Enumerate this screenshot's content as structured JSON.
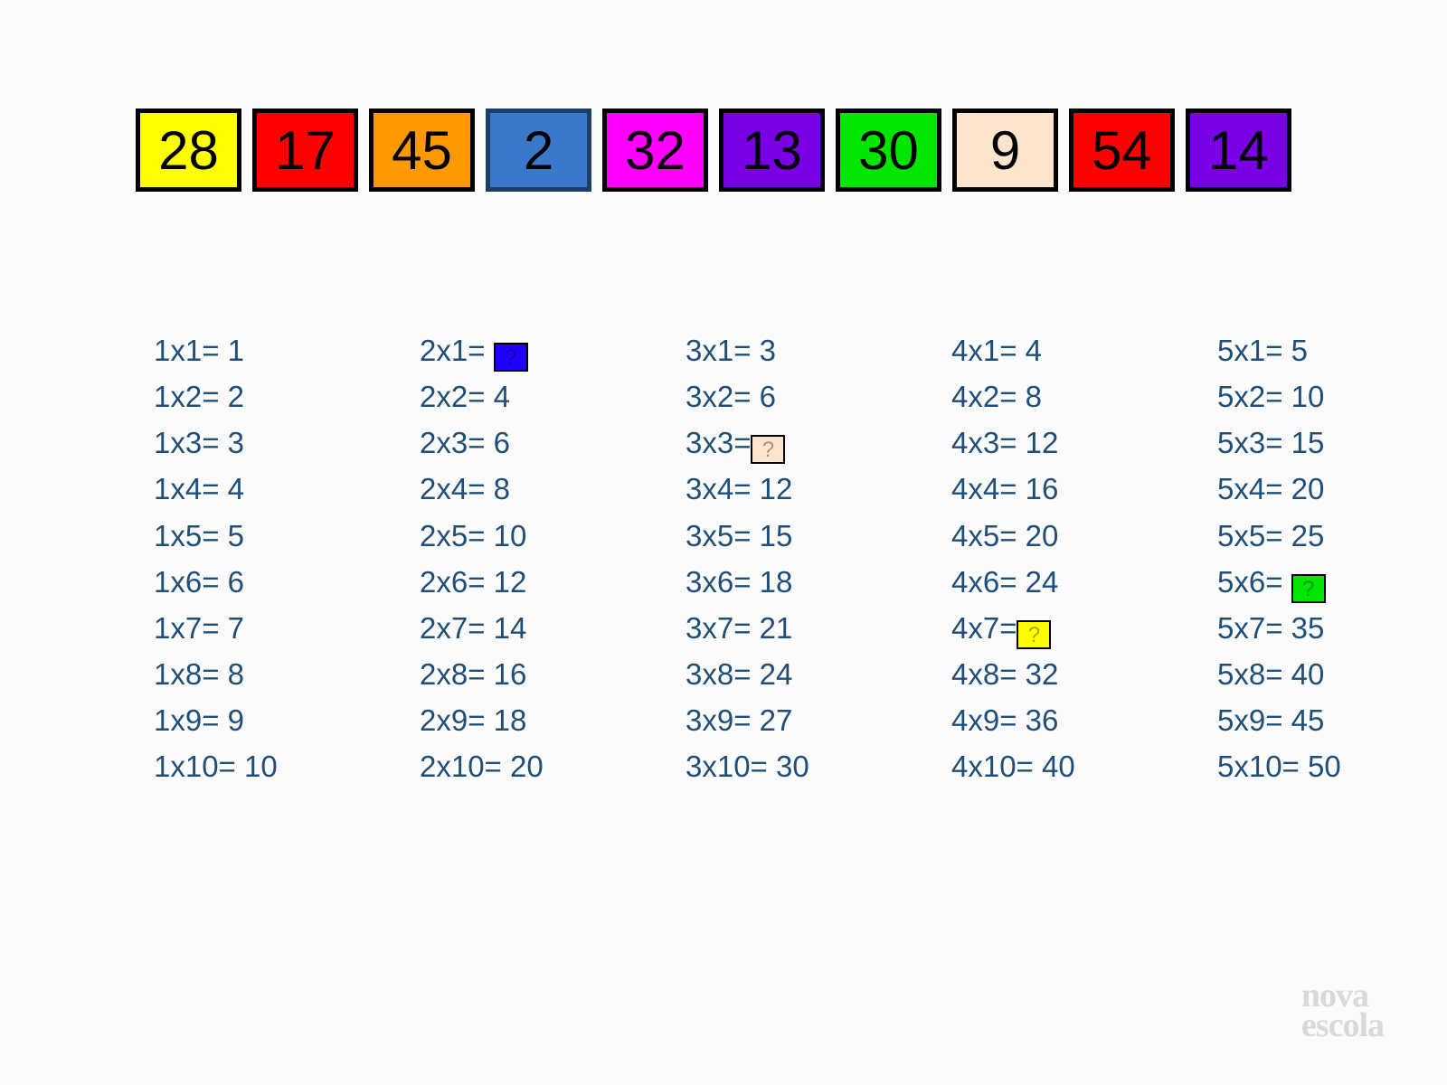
{
  "boxes": [
    {
      "value": "28",
      "bg": "#ffff00",
      "border": "#000000",
      "fg": "#000000"
    },
    {
      "value": "17",
      "bg": "#ff0000",
      "border": "#000000",
      "fg": "#000000"
    },
    {
      "value": "45",
      "bg": "#ff9900",
      "border": "#000000",
      "fg": "#000000"
    },
    {
      "value": "2",
      "bg": "#3a78c9",
      "border": "#1b3f66",
      "fg": "#000000"
    },
    {
      "value": "32",
      "bg": "#ff00ff",
      "border": "#000000",
      "fg": "#000000"
    },
    {
      "value": "13",
      "bg": "#7a00e6",
      "border": "#000000",
      "fg": "#000000"
    },
    {
      "value": "30",
      "bg": "#00e600",
      "border": "#000000",
      "fg": "#000000"
    },
    {
      "value": "9",
      "bg": "#fce5cd",
      "border": "#000000",
      "fg": "#000000"
    },
    {
      "value": "54",
      "bg": "#ff0000",
      "border": "#000000",
      "fg": "#000000"
    },
    {
      "value": "14",
      "bg": "#7a00e6",
      "border": "#000000",
      "fg": "#000000"
    }
  ],
  "tables": [
    {
      "factor": 1,
      "rows": [
        {
          "expr": "1x1= ",
          "result": "1",
          "hidden": false
        },
        {
          "expr": "1x2= ",
          "result": "2",
          "hidden": false
        },
        {
          "expr": "1x3= ",
          "result": "3",
          "hidden": false
        },
        {
          "expr": "1x4= ",
          "result": "4",
          "hidden": false
        },
        {
          "expr": "1x5= ",
          "result": "5",
          "hidden": false
        },
        {
          "expr": "1x6= ",
          "result": "6",
          "hidden": false
        },
        {
          "expr": "1x7= ",
          "result": "7",
          "hidden": false
        },
        {
          "expr": "1x8= ",
          "result": "8",
          "hidden": false
        },
        {
          "expr": "1x9= ",
          "result": "9",
          "hidden": false
        },
        {
          "expr": "1x10= ",
          "result": "10",
          "hidden": false
        }
      ]
    },
    {
      "factor": 2,
      "rows": [
        {
          "expr": "2x1= ",
          "result": "?",
          "hidden": true,
          "bg": "#1f00ff",
          "border": "#000000"
        },
        {
          "expr": "2x2= ",
          "result": "4",
          "hidden": false
        },
        {
          "expr": "2x3= ",
          "result": "6",
          "hidden": false
        },
        {
          "expr": "2x4= ",
          "result": "8",
          "hidden": false
        },
        {
          "expr": "2x5= ",
          "result": "10",
          "hidden": false
        },
        {
          "expr": "2x6= ",
          "result": "12",
          "hidden": false
        },
        {
          "expr": "2x7= ",
          "result": "14",
          "hidden": false
        },
        {
          "expr": "2x8= ",
          "result": "16",
          "hidden": false
        },
        {
          "expr": "2x9= ",
          "result": "18",
          "hidden": false
        },
        {
          "expr": "2x10= ",
          "result": "20",
          "hidden": false
        }
      ]
    },
    {
      "factor": 3,
      "rows": [
        {
          "expr": "3x1= ",
          "result": "3",
          "hidden": false
        },
        {
          "expr": "3x2= ",
          "result": "6",
          "hidden": false
        },
        {
          "expr": "3x3=",
          "result": "?",
          "hidden": true,
          "bg": "#fce5cd",
          "border": "#000000"
        },
        {
          "expr": "3x4= ",
          "result": "12",
          "hidden": false
        },
        {
          "expr": "3x5= ",
          "result": "15",
          "hidden": false
        },
        {
          "expr": "3x6= ",
          "result": "18",
          "hidden": false
        },
        {
          "expr": "3x7= ",
          "result": "21",
          "hidden": false
        },
        {
          "expr": "3x8= ",
          "result": "24",
          "hidden": false
        },
        {
          "expr": "3x9= ",
          "result": "27",
          "hidden": false
        },
        {
          "expr": "3x10= ",
          "result": "30",
          "hidden": false
        }
      ]
    },
    {
      "factor": 4,
      "rows": [
        {
          "expr": "4x1= ",
          "result": "4",
          "hidden": false
        },
        {
          "expr": "4x2= ",
          "result": "8",
          "hidden": false
        },
        {
          "expr": "4x3= ",
          "result": "12",
          "hidden": false
        },
        {
          "expr": "4x4= ",
          "result": "16",
          "hidden": false
        },
        {
          "expr": "4x5= ",
          "result": "20",
          "hidden": false
        },
        {
          "expr": "4x6= ",
          "result": "24",
          "hidden": false
        },
        {
          "expr": "4x7=",
          "result": "?",
          "hidden": true,
          "bg": "#ffff00",
          "border": "#000000"
        },
        {
          "expr": "4x8= ",
          "result": "32",
          "hidden": false
        },
        {
          "expr": "4x9= ",
          "result": "36",
          "hidden": false
        },
        {
          "expr": "4x10= ",
          "result": "40",
          "hidden": false
        }
      ]
    },
    {
      "factor": 5,
      "rows": [
        {
          "expr": "5x1= ",
          "result": "5",
          "hidden": false
        },
        {
          "expr": "5x2= ",
          "result": "10",
          "hidden": false
        },
        {
          "expr": "5x3= ",
          "result": "15",
          "hidden": false
        },
        {
          "expr": "5x4= ",
          "result": "20",
          "hidden": false
        },
        {
          "expr": "5x5= ",
          "result": "25",
          "hidden": false
        },
        {
          "expr": "5x6= ",
          "result": "?",
          "hidden": true,
          "bg": "#00e600",
          "border": "#000000"
        },
        {
          "expr": "5x7= ",
          "result": "35",
          "hidden": false
        },
        {
          "expr": "5x8= ",
          "result": "40",
          "hidden": false
        },
        {
          "expr": "5x9= ",
          "result": "45",
          "hidden": false
        },
        {
          "expr": "5x10= ",
          "result": "50",
          "hidden": false
        }
      ]
    }
  ],
  "logo": {
    "line1": "nova",
    "line2": "escola"
  }
}
